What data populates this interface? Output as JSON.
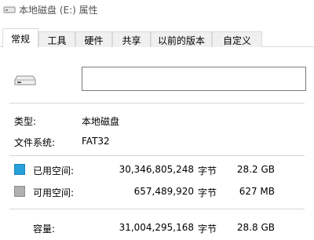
{
  "window": {
    "title": "本地磁盘 (E:) 属性"
  },
  "tabs": [
    {
      "label": "常规"
    },
    {
      "label": "工具"
    },
    {
      "label": "硬件"
    },
    {
      "label": "共享"
    },
    {
      "label": "以前的版本"
    },
    {
      "label": "自定义"
    }
  ],
  "general": {
    "volume_label_value": "",
    "type_label": "类型:",
    "type_value": "本地磁盘",
    "fs_label": "文件系统:",
    "fs_value": "FAT32",
    "used": {
      "label": "已用空间:",
      "bytes": "30,346,805,248",
      "unit": "字节",
      "size": "28.2 GB",
      "color": "#26a0da"
    },
    "free": {
      "label": "可用空间:",
      "bytes": "657,489,920",
      "unit": "字节",
      "size": "627 MB",
      "color": "#b0b0b0"
    },
    "capacity": {
      "label": "容量:",
      "bytes": "31,004,295,168",
      "unit": "字节",
      "size": "28.8 GB"
    }
  }
}
